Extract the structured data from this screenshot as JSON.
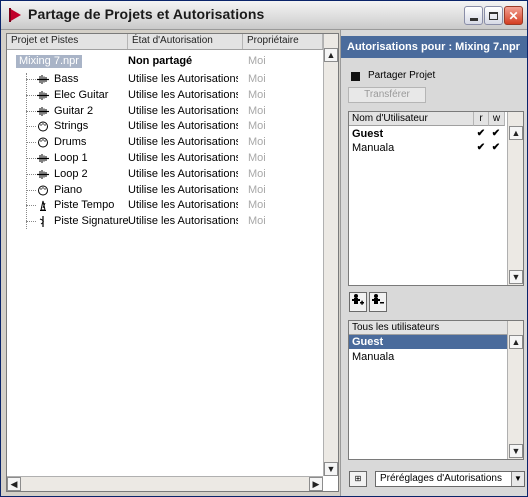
{
  "window": {
    "title": "Partage de Projets et Autorisations",
    "close_glyph": "✕"
  },
  "tree": {
    "columns": [
      "Projet et Pistes",
      "État d'Autorisation",
      "Propriétaire"
    ],
    "root": {
      "name": "Mixing 7.npr",
      "state": "Non partagé",
      "owner": "Moi"
    },
    "tracks": [
      {
        "name": "Bass",
        "icon": "audio-track-icon",
        "state": "Utilise les Autorisations Pro",
        "owner": "Moi"
      },
      {
        "name": "Elec Guitar",
        "icon": "audio-track-icon",
        "state": "Utilise les Autorisations Pro",
        "owner": "Moi"
      },
      {
        "name": "Guitar 2",
        "icon": "audio-track-icon",
        "state": "Utilise les Autorisations Pro",
        "owner": "Moi"
      },
      {
        "name": "Strings",
        "icon": "midi-track-icon",
        "state": "Utilise les Autorisations Pro",
        "owner": "Moi"
      },
      {
        "name": "Drums",
        "icon": "midi-track-icon",
        "state": "Utilise les Autorisations Pro",
        "owner": "Moi"
      },
      {
        "name": "Loop 1",
        "icon": "audio-track-icon",
        "state": "Utilise les Autorisations Pro",
        "owner": "Moi"
      },
      {
        "name": "Loop 2",
        "icon": "audio-track-icon",
        "state": "Utilise les Autorisations Pro",
        "owner": "Moi"
      },
      {
        "name": "Piano",
        "icon": "midi-track-icon",
        "state": "Utilise les Autorisations Pro",
        "owner": "Moi"
      },
      {
        "name": "Piste Tempo",
        "icon": "tempo-track-icon",
        "state": "Utilise les Autorisations Pro",
        "owner": "Moi"
      },
      {
        "name": "Piste Signature",
        "icon": "signature-track-icon",
        "state": "Utilise les Autorisations Pro",
        "owner": "Moi"
      }
    ]
  },
  "scroll": {
    "up": "▲",
    "down": "▼",
    "left": "◀",
    "right": "▶"
  },
  "permissions": {
    "header": "Autorisations pour : Mixing 7.npr",
    "share_label": "Partager Projet",
    "transfer_label": "Transférer",
    "columns": {
      "user": "Nom d'Utilisateur",
      "r": "r",
      "w": "w"
    },
    "users": [
      {
        "name": "Guest",
        "r": "✔",
        "w": "✔"
      },
      {
        "name": "Manuala",
        "r": "✔",
        "w": "✔"
      }
    ]
  },
  "all_users": {
    "header": "Tous les utilisateurs",
    "users": [
      "Guest",
      "Manuala"
    ],
    "selected": "Guest"
  },
  "presets": {
    "label": "Préréglages d'Autorisations",
    "icon_text": "⊞"
  },
  "colors": {
    "accent": "#4a6b9c",
    "selection": "#a9b4c7"
  }
}
